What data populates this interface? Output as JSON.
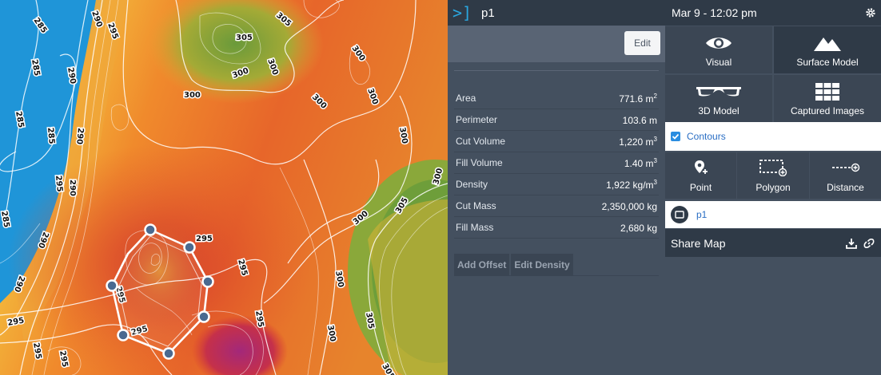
{
  "map": {
    "contour_labels": [
      "285",
      "290",
      "295",
      "300",
      "305"
    ]
  },
  "detail": {
    "logo": ">]",
    "title": "p1",
    "edit_label": "Edit",
    "properties": [
      {
        "key": "Area",
        "value": "771.6 m",
        "unit_sup": "2"
      },
      {
        "key": "Perimeter",
        "value": "103.6 m",
        "unit_sup": ""
      },
      {
        "key": "Cut Volume",
        "value": "1,220 m",
        "unit_sup": "3"
      },
      {
        "key": "Fill Volume",
        "value": "1.40 m",
        "unit_sup": "3"
      },
      {
        "key": "Density",
        "value": "1,922 kg/m",
        "unit_sup": "3"
      },
      {
        "key": "Cut Mass",
        "value": "2,350,000 kg",
        "unit_sup": ""
      },
      {
        "key": "Fill Mass",
        "value": "2,680 kg",
        "unit_sup": ""
      }
    ],
    "add_offset_label": "Add Offset",
    "edit_density_label": "Edit Density"
  },
  "panel": {
    "datetime": "Mar 9 - 12:02 pm",
    "views": [
      {
        "label": "Visual",
        "icon": "eye-icon",
        "active": false
      },
      {
        "label": "Surface Model",
        "icon": "mountain-icon",
        "active": true
      },
      {
        "label": "3D Model",
        "icon": "glasses-icon",
        "active": false
      },
      {
        "label": "Captured Images",
        "icon": "grid-icon",
        "active": false
      }
    ],
    "contours_label": "Contours",
    "contours_checked": true,
    "tools": [
      {
        "label": "Point",
        "icon": "add-point-icon"
      },
      {
        "label": "Polygon",
        "icon": "add-polygon-icon"
      },
      {
        "label": "Distance",
        "icon": "add-distance-icon"
      }
    ],
    "layer_label": "p1",
    "share_label": "Share Map"
  },
  "colors": {
    "accent": "#2a8de0",
    "header": "#2f3a47",
    "panel": "#44505f"
  }
}
